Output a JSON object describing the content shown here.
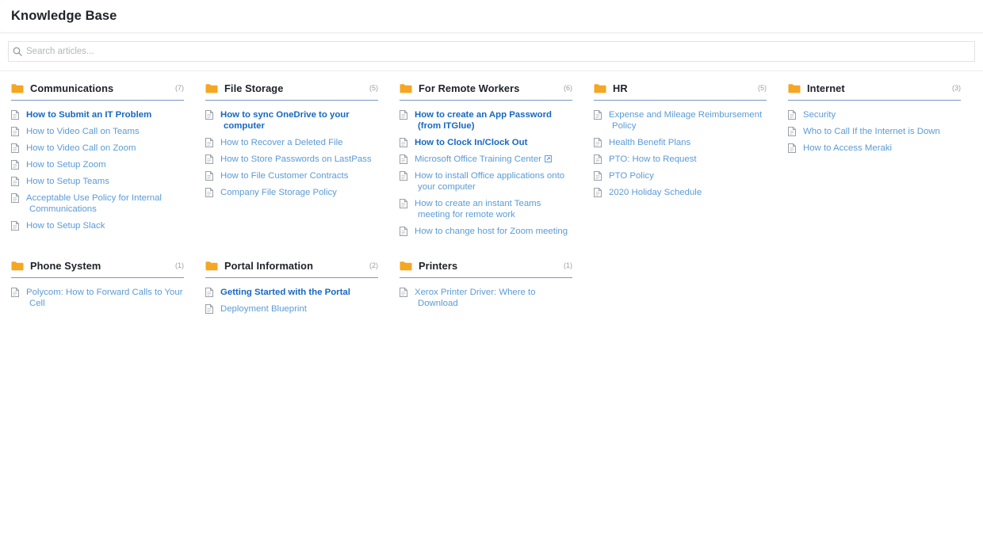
{
  "header": {
    "title": "Knowledge Base"
  },
  "search": {
    "placeholder": "Search articles...",
    "value": "",
    "icon": "search-icon"
  },
  "icons": {
    "folder": "folder-icon",
    "document": "document-icon",
    "external_link": "external-link-icon"
  },
  "colors": {
    "folder": "#F5A623",
    "link": "#5b9bd5",
    "link_featured": "#1668c1",
    "header_rule": "#7b96c4",
    "title": "#20232a",
    "count": "#9b9ea2"
  },
  "categories": [
    {
      "name": "Communications",
      "count": "(7)",
      "articles": [
        {
          "title": "How to Submit an IT Problem",
          "featured": true,
          "external": false
        },
        {
          "title": "How to Video Call on Teams",
          "featured": false,
          "external": false
        },
        {
          "title": "How to Video Call on Zoom",
          "featured": false,
          "external": false
        },
        {
          "title": "How to Setup Zoom",
          "featured": false,
          "external": false
        },
        {
          "title": "How to Setup Teams",
          "featured": false,
          "external": false
        },
        {
          "title": "Acceptable Use Policy for Internal Communications",
          "featured": false,
          "external": false
        },
        {
          "title": "How to Setup Slack",
          "featured": false,
          "external": false
        }
      ]
    },
    {
      "name": "File Storage",
      "count": "(5)",
      "articles": [
        {
          "title": "How to sync OneDrive to your computer",
          "featured": true,
          "external": false
        },
        {
          "title": "How to Recover a Deleted File",
          "featured": false,
          "external": false
        },
        {
          "title": "How to Store Passwords on LastPass",
          "featured": false,
          "external": false
        },
        {
          "title": "How to File Customer Contracts",
          "featured": false,
          "external": false
        },
        {
          "title": "Company File Storage Policy",
          "featured": false,
          "external": false
        }
      ]
    },
    {
      "name": "For Remote Workers",
      "count": "(6)",
      "articles": [
        {
          "title": "How to create an App Password (from ITGlue)",
          "featured": true,
          "external": false
        },
        {
          "title": "How to Clock In/Clock Out",
          "featured": true,
          "external": false
        },
        {
          "title": "Microsoft Office Training Center",
          "featured": false,
          "external": true
        },
        {
          "title": "How to install Office applications onto your computer",
          "featured": false,
          "external": false
        },
        {
          "title": "How to create an instant Teams meeting for remote work",
          "featured": false,
          "external": false
        },
        {
          "title": "How to change host for Zoom meeting",
          "featured": false,
          "external": false
        }
      ]
    },
    {
      "name": "HR",
      "count": "(5)",
      "articles": [
        {
          "title": "Expense and Mileage Reimbursement Policy",
          "featured": false,
          "external": false
        },
        {
          "title": "Health Benefit Plans",
          "featured": false,
          "external": false
        },
        {
          "title": "PTO: How to Request",
          "featured": false,
          "external": false
        },
        {
          "title": "PTO Policy",
          "featured": false,
          "external": false
        },
        {
          "title": "2020 Holiday Schedule",
          "featured": false,
          "external": false
        }
      ]
    },
    {
      "name": "Internet",
      "count": "(3)",
      "articles": [
        {
          "title": "Security",
          "featured": false,
          "external": false
        },
        {
          "title": "Who to Call If the Internet is Down",
          "featured": false,
          "external": false
        },
        {
          "title": "How to Access Meraki",
          "featured": false,
          "external": false
        }
      ]
    },
    {
      "name": "Phone System",
      "count": "(1)",
      "articles": [
        {
          "title": "Polycom: How to Forward Calls to Your Cell",
          "featured": false,
          "external": false
        }
      ]
    },
    {
      "name": "Portal Information",
      "count": "(2)",
      "articles": [
        {
          "title": "Getting Started with the Portal",
          "featured": true,
          "external": false
        },
        {
          "title": "Deployment Blueprint",
          "featured": false,
          "external": false
        }
      ]
    },
    {
      "name": "Printers",
      "count": "(1)",
      "articles": [
        {
          "title": "Xerox Printer Driver: Where to Download",
          "featured": false,
          "external": false
        }
      ]
    }
  ]
}
